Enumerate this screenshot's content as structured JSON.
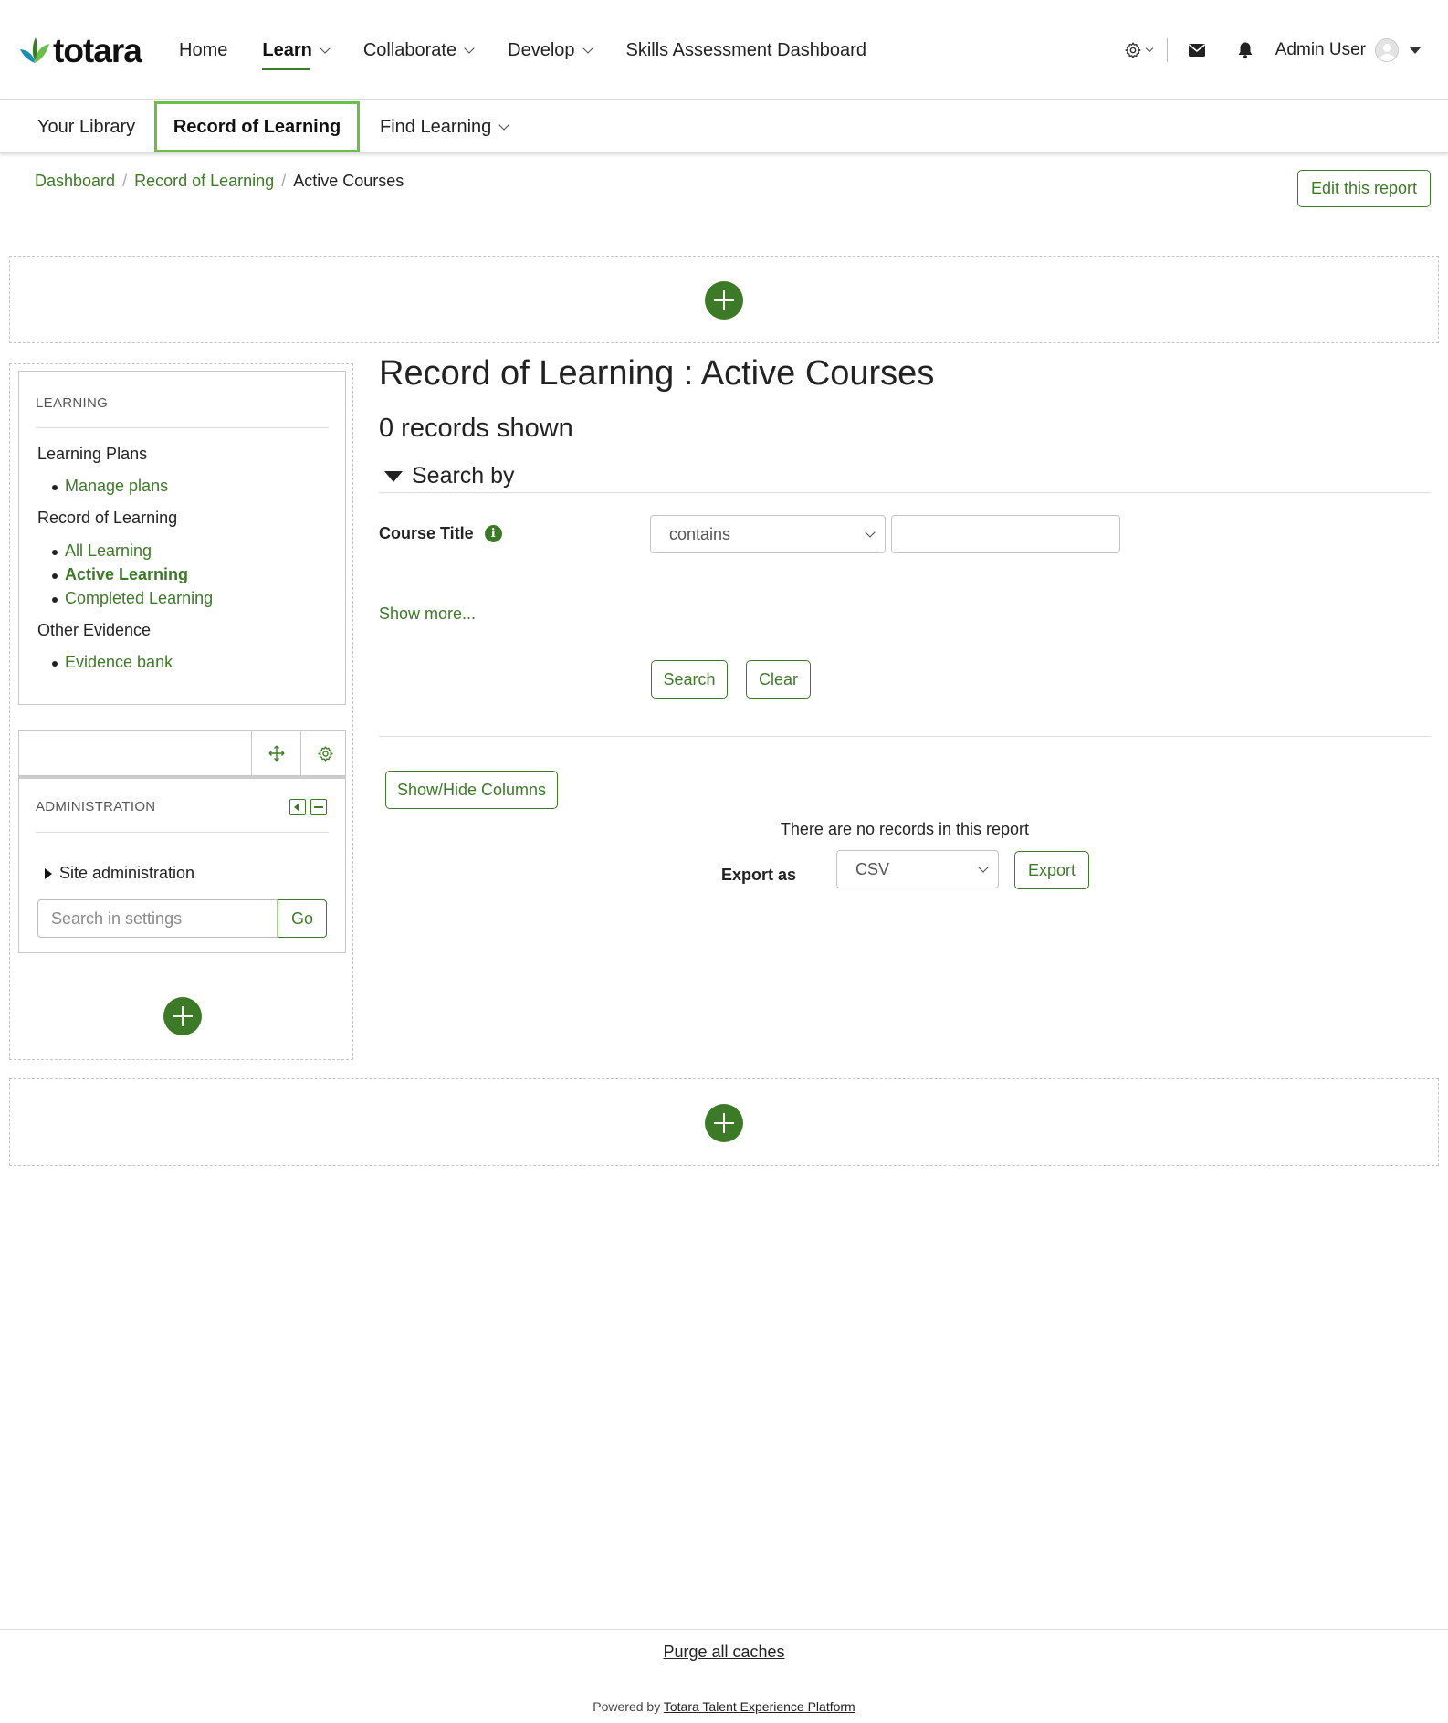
{
  "brand": {
    "name": "totara",
    "accent": "#3d7a28",
    "highlight": "#6abf4b"
  },
  "topnav": {
    "items": [
      {
        "label": "Home",
        "dropdown": false,
        "active": false
      },
      {
        "label": "Learn",
        "dropdown": true,
        "active": true
      },
      {
        "label": "Collaborate",
        "dropdown": true,
        "active": false
      },
      {
        "label": "Develop",
        "dropdown": true,
        "active": false
      },
      {
        "label": "Skills Assessment Dashboard",
        "dropdown": false,
        "active": false
      }
    ],
    "icons": {
      "settings": "gear-icon",
      "messages": "envelope-icon",
      "notifications": "bell-icon"
    },
    "user_name": "Admin User"
  },
  "subnav": {
    "items": [
      {
        "label": "Your Library"
      },
      {
        "label": "Record of Learning"
      },
      {
        "label": "Find Learning"
      }
    ]
  },
  "breadcrumb": {
    "items": [
      "Dashboard",
      "Record of Learning"
    ],
    "current": "Active Courses"
  },
  "edit_report_label": "Edit this report",
  "learning_block": {
    "title": "LEARNING",
    "groups": [
      {
        "heading": "Learning Plans",
        "links": [
          "Manage plans"
        ]
      },
      {
        "heading": "Record of Learning",
        "links": [
          "All Learning",
          "Active Learning",
          "Completed Learning"
        ]
      },
      {
        "heading": "Other Evidence",
        "links": [
          "Evidence bank"
        ]
      }
    ],
    "current_link": "Active Learning"
  },
  "admin_block": {
    "title": "ADMINISTRATION",
    "site_admin": "Site administration",
    "search_placeholder": "Search in settings",
    "go_label": "Go"
  },
  "main": {
    "title": "Record of Learning : Active Courses",
    "records_shown": "0 records shown",
    "search_by": "Search by",
    "filter": {
      "label": "Course Title",
      "operator": "contains",
      "value": ""
    },
    "show_more": "Show more...",
    "search_label": "Search",
    "clear_label": "Clear",
    "show_hide_columns": "Show/Hide Columns",
    "no_records": "There are no records in this report",
    "export_label": "Export as",
    "export_format": "CSV",
    "export_button": "Export"
  },
  "footer": {
    "purge": "Purge all caches",
    "powered_prefix": "Powered by",
    "powered_link": "Totara Talent Experience Platform"
  }
}
